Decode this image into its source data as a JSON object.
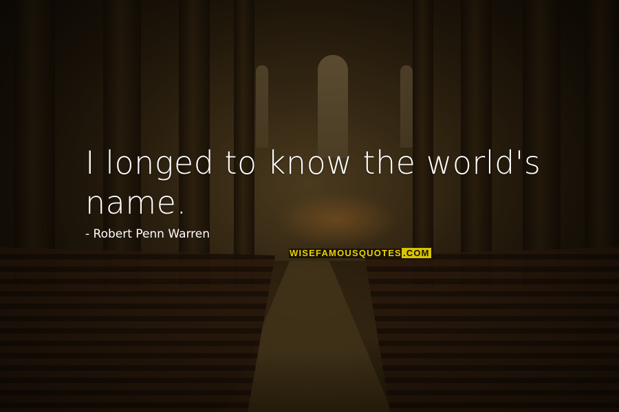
{
  "quote": {
    "text": "I longed to know the world's name.",
    "author": "- Robert Penn Warren"
  },
  "watermark": {
    "part1": "WISEFAMOUSQUOTES",
    "part2": ".COM",
    "color": "#e8d300"
  }
}
